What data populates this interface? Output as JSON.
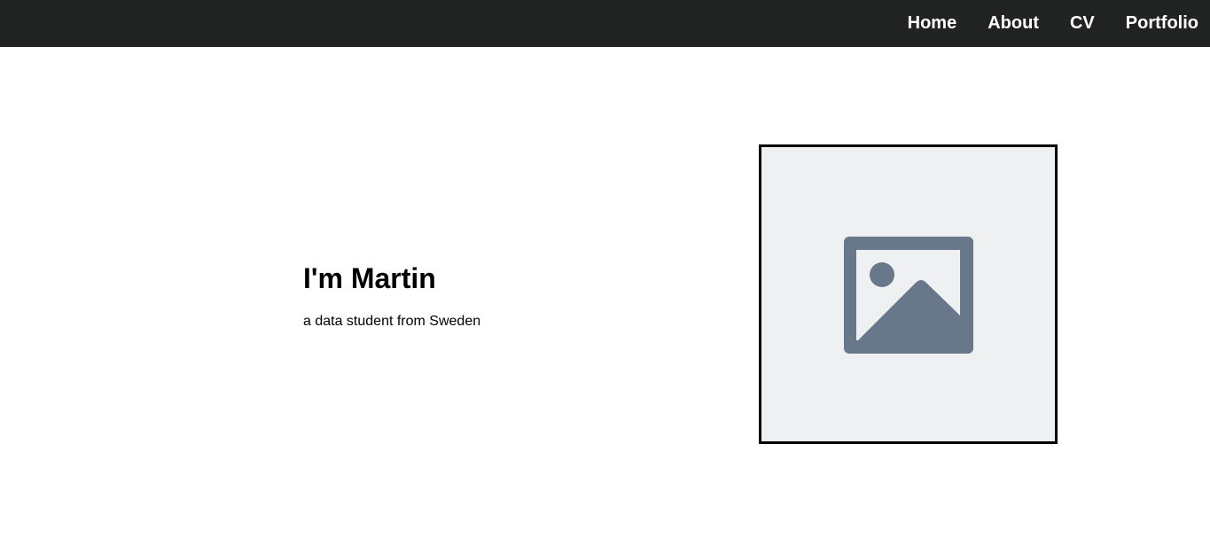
{
  "nav": {
    "items": [
      {
        "label": "Home"
      },
      {
        "label": "About"
      },
      {
        "label": "CV"
      },
      {
        "label": "Portfolio"
      }
    ]
  },
  "hero": {
    "title": "I'm Martin",
    "subtitle": "a data student from Sweden",
    "image_icon": "image-placeholder-icon"
  },
  "colors": {
    "navbar_bg": "#212322",
    "nav_text": "#ffffff",
    "frame_border": "#000000",
    "frame_bg": "#eff0f2",
    "icon": "#687789"
  }
}
